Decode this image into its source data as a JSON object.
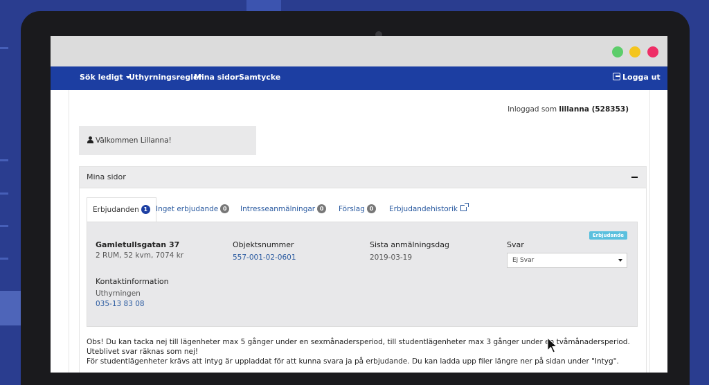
{
  "window": {
    "controls": [
      "green",
      "yellow",
      "red"
    ]
  },
  "nav": {
    "items": [
      {
        "label": "Sök ledigt",
        "has_dropdown": true
      },
      {
        "label": "Uthyrningsregler"
      },
      {
        "label": "Mina sidor"
      },
      {
        "label": "Samtycke"
      }
    ],
    "logout_label": "Logga ut"
  },
  "session": {
    "logged_in_prefix": "Inloggad som",
    "username": "lillanna (528353)"
  },
  "welcome_text": "Välkommen Lillanna!",
  "panel": {
    "title": "Mina sidor",
    "tabs": [
      {
        "label": "Erbjudanden",
        "count": "1",
        "active": true
      },
      {
        "label": "Inget erbjudande",
        "count": "0"
      },
      {
        "label": "Intresseanmälningar",
        "count": "0"
      },
      {
        "label": "Förslag",
        "count": "0"
      },
      {
        "label": "Erbjudandehistorik",
        "external": true
      }
    ]
  },
  "offer": {
    "tag": "Erbjudande",
    "address": "Gamletullsgatan 37",
    "details": "2 RUM, 52 kvm, 7074 kr",
    "object_label": "Objektsnummer",
    "object_number": "557-001-02-0601",
    "deadline_label": "Sista anmälningsdag",
    "deadline": "2019-03-19",
    "answer_label": "Svar",
    "answer_selected": "Ej Svar",
    "contact_label": "Kontaktinformation",
    "contact_name": "Uthyrningen",
    "contact_phone": "035-13 83 08"
  },
  "notice": {
    "line1": "Obs! Du kan tacka nej till lägenheter max 5 gånger under en sexmånadersperiod, till studentlägenheter max 3 gånger under en tvåmånadersperiod. Uteblivet svar räknas som nej!",
    "line2": "För studentlägenheter krävs att intyg är uppladdat för att kunna svara ja på erbjudande. Du kan ladda upp filer längre ner på sidan under \"Intyg\"."
  },
  "colors": {
    "nav_bg": "#1c3ea2",
    "badge_active": "#1c3ea2",
    "tag_bg": "#5bc0de",
    "link": "#2a5aa0"
  }
}
